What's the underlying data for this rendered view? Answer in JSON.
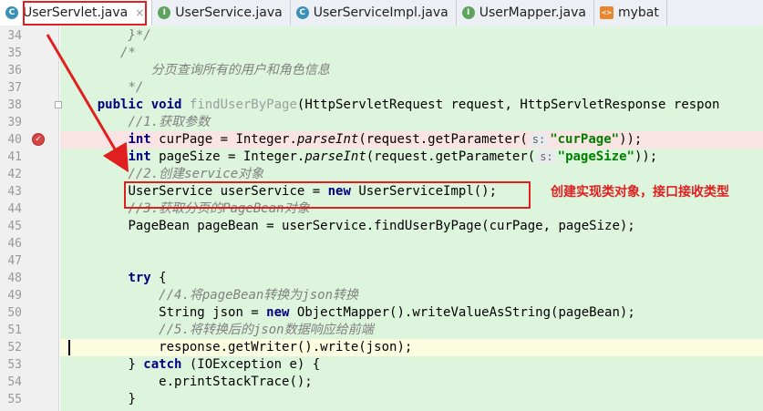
{
  "tabs": [
    {
      "label": "UserServlet.java",
      "icon": "class-icon",
      "letter": "C",
      "kind": "cls",
      "active": true,
      "closable": true
    },
    {
      "label": "UserService.java",
      "icon": "interface-icon",
      "letter": "I",
      "kind": "ifc",
      "active": false,
      "closable": false
    },
    {
      "label": "UserServiceImpl.java",
      "icon": "class-icon",
      "letter": "C",
      "kind": "cls",
      "active": false,
      "closable": false
    },
    {
      "label": "UserMapper.java",
      "icon": "interface-icon",
      "letter": "I",
      "kind": "ifc",
      "active": false,
      "closable": false
    },
    {
      "label": "mybat",
      "icon": "xml-icon",
      "letter": "<>",
      "kind": "xml",
      "active": false,
      "closable": false
    }
  ],
  "close_glyph": "×",
  "lines": [
    {
      "n": "34",
      "tokens": [
        {
          "t": "        ",
          "c": ""
        },
        {
          "t": "}*/",
          "c": "cm"
        }
      ]
    },
    {
      "n": "35",
      "tokens": [
        {
          "t": "       ",
          "c": ""
        },
        {
          "t": "/*",
          "c": "cm"
        }
      ]
    },
    {
      "n": "36",
      "tokens": [
        {
          "t": "           ",
          "c": ""
        },
        {
          "t": "分页查询所有的用户和角色信息",
          "c": "cm"
        }
      ]
    },
    {
      "n": "37",
      "tokens": [
        {
          "t": "        ",
          "c": ""
        },
        {
          "t": "*/",
          "c": "cm"
        }
      ]
    },
    {
      "n": "38",
      "fold": true,
      "tokens": [
        {
          "t": "    ",
          "c": ""
        },
        {
          "t": "public void ",
          "c": "kw"
        },
        {
          "t": "findUserByPage",
          "c": "fade"
        },
        {
          "t": "(HttpServletRequest request, HttpServletResponse respon",
          "c": ""
        }
      ]
    },
    {
      "n": "39",
      "tokens": [
        {
          "t": "        ",
          "c": ""
        },
        {
          "t": "//1.获取参数",
          "c": "cm"
        }
      ]
    },
    {
      "n": "40",
      "breakpoint": true,
      "tokens": [
        {
          "t": "        ",
          "c": ""
        },
        {
          "t": "int ",
          "c": "kw"
        },
        {
          "t": "curPage = Integer.",
          "c": ""
        },
        {
          "t": "parseInt",
          "c": "it"
        },
        {
          "t": "(request.getParameter(",
          "c": ""
        },
        {
          "hint": "s:"
        },
        {
          "t": "\"curPage\"",
          "c": "st"
        },
        {
          "t": "));",
          "c": ""
        }
      ]
    },
    {
      "n": "41",
      "tokens": [
        {
          "t": "        ",
          "c": ""
        },
        {
          "t": "int ",
          "c": "kw"
        },
        {
          "t": "pageSize = Integer.",
          "c": ""
        },
        {
          "t": "parseInt",
          "c": "it"
        },
        {
          "t": "(request.getParameter(",
          "c": ""
        },
        {
          "hint": "s:"
        },
        {
          "t": "\"pageSize\"",
          "c": "st"
        },
        {
          "t": "));",
          "c": ""
        }
      ]
    },
    {
      "n": "42",
      "tokens": [
        {
          "t": "        ",
          "c": ""
        },
        {
          "t": "//2.创建service对象",
          "c": "cm"
        }
      ]
    },
    {
      "n": "43",
      "tokens": [
        {
          "t": "        ",
          "c": ""
        },
        {
          "t": "UserService userService = ",
          "c": ""
        },
        {
          "t": "new ",
          "c": "kw"
        },
        {
          "t": "UserServiceImpl();",
          "c": ""
        }
      ]
    },
    {
      "n": "44",
      "tokens": [
        {
          "t": "        ",
          "c": ""
        },
        {
          "t": "//3.获取分页的PageBean对象",
          "c": "cm"
        }
      ]
    },
    {
      "n": "45",
      "tokens": [
        {
          "t": "        ",
          "c": ""
        },
        {
          "t": "PageBean pageBean = userService.findUserByPage(curPage, pageSize);",
          "c": ""
        }
      ]
    },
    {
      "n": "46",
      "tokens": []
    },
    {
      "n": "47",
      "tokens": []
    },
    {
      "n": "48",
      "tokens": [
        {
          "t": "        ",
          "c": ""
        },
        {
          "t": "try ",
          "c": "kw"
        },
        {
          "t": "{",
          "c": ""
        }
      ]
    },
    {
      "n": "49",
      "tokens": [
        {
          "t": "            ",
          "c": ""
        },
        {
          "t": "//4.将pageBean转换为json转换",
          "c": "cm"
        }
      ]
    },
    {
      "n": "50",
      "tokens": [
        {
          "t": "            ",
          "c": ""
        },
        {
          "t": "String json = ",
          "c": ""
        },
        {
          "t": "new ",
          "c": "kw"
        },
        {
          "t": "ObjectMapper().writeValueAsString(pageBean);",
          "c": ""
        }
      ]
    },
    {
      "n": "51",
      "tokens": [
        {
          "t": "            ",
          "c": ""
        },
        {
          "t": "//5.将转换后的json数据响应给前端",
          "c": "cm"
        }
      ]
    },
    {
      "n": "52",
      "current": true,
      "tokens": [
        {
          "t": "            ",
          "c": ""
        },
        {
          "t": "response.getWriter().write(json);",
          "c": ""
        }
      ]
    },
    {
      "n": "53",
      "tokens": [
        {
          "t": "        ",
          "c": ""
        },
        {
          "t": "} ",
          "c": ""
        },
        {
          "t": "catch ",
          "c": "kw"
        },
        {
          "t": "(IOException e) {",
          "c": ""
        }
      ]
    },
    {
      "n": "54",
      "tokens": [
        {
          "t": "            ",
          "c": ""
        },
        {
          "t": "e.printStackTrace();",
          "c": ""
        }
      ]
    },
    {
      "n": "55",
      "tokens": [
        {
          "t": "        ",
          "c": ""
        },
        {
          "t": "}",
          "c": ""
        }
      ]
    }
  ],
  "annotation": {
    "text": "创建实现类对象，接口接收类型",
    "color": "#e02020"
  }
}
